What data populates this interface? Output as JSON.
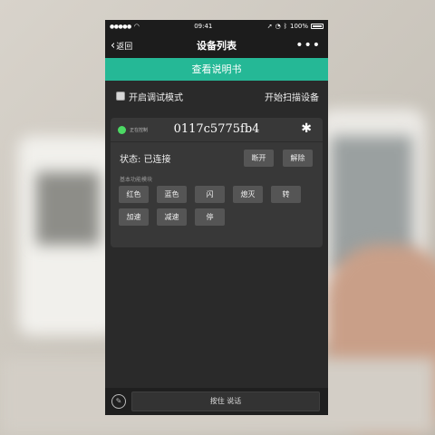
{
  "status_bar": {
    "time": "09:41",
    "battery": "100%"
  },
  "nav": {
    "back_label": "返回",
    "title": "设备列表",
    "more": "•••"
  },
  "manual_button": "查看说明书",
  "options": {
    "debug_label": "开启调试模式",
    "scan_label": "开始扫描设备"
  },
  "device": {
    "status_label": "正在控制",
    "id": "0117c5775fb4",
    "state": "状态: 已连接",
    "disconnect_label": "断开",
    "unbind_label": "解除",
    "section_label": "基本功能模块",
    "functions": [
      "红色",
      "蓝色",
      "闪",
      "熄灭",
      "转",
      "加速",
      "减速",
      "停"
    ]
  },
  "bottom": {
    "talk_label": "按住 说话"
  },
  "colors": {
    "accent": "#25b896",
    "status_dot": "#4cd964",
    "background": "#2a2a2a"
  }
}
